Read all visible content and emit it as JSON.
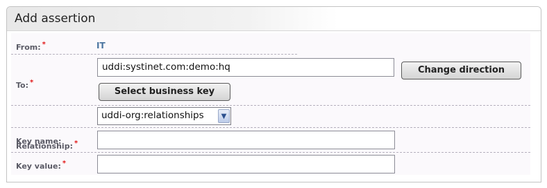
{
  "panel": {
    "title": "Add assertion"
  },
  "form": {
    "from": {
      "label": "From:",
      "value": "IT"
    },
    "to": {
      "label": "To:",
      "value": "uddi:systinet.com:demo:hq",
      "select_business_key_label": "Select business key",
      "change_direction_label": "Change direction"
    },
    "relationship": {
      "label": "Relationship:",
      "selected": "uddi-org:relationships"
    },
    "key_name": {
      "label": "Key name:",
      "value": ""
    },
    "key_value": {
      "label": "Key value:",
      "value": ""
    },
    "required_mark": "*"
  },
  "icons": [
    "chevron-down-icon"
  ]
}
